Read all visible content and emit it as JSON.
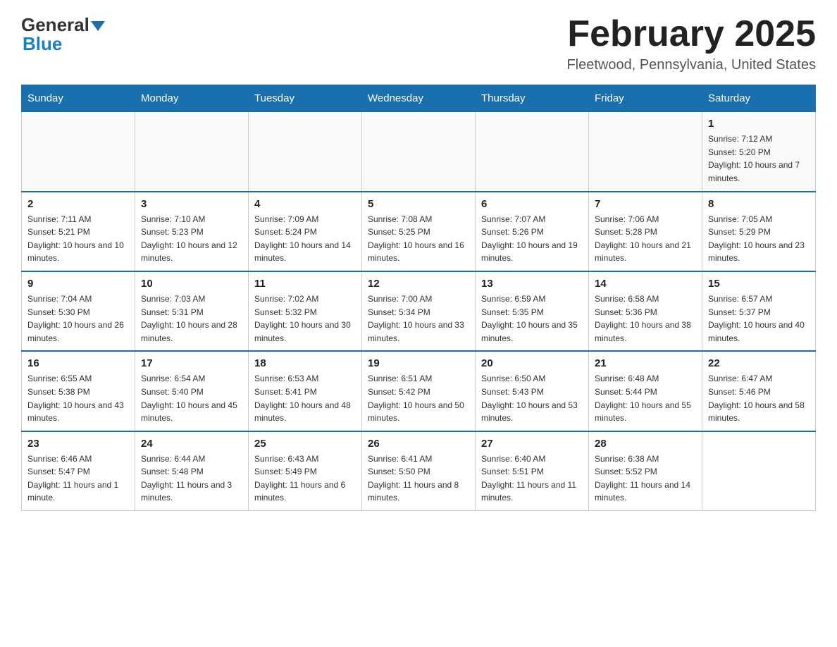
{
  "header": {
    "logo_general": "General",
    "logo_blue": "Blue",
    "month_title": "February 2025",
    "location": "Fleetwood, Pennsylvania, United States"
  },
  "days_of_week": [
    "Sunday",
    "Monday",
    "Tuesday",
    "Wednesday",
    "Thursday",
    "Friday",
    "Saturday"
  ],
  "weeks": [
    [
      {
        "day": "",
        "sunrise": "",
        "sunset": "",
        "daylight": ""
      },
      {
        "day": "",
        "sunrise": "",
        "sunset": "",
        "daylight": ""
      },
      {
        "day": "",
        "sunrise": "",
        "sunset": "",
        "daylight": ""
      },
      {
        "day": "",
        "sunrise": "",
        "sunset": "",
        "daylight": ""
      },
      {
        "day": "",
        "sunrise": "",
        "sunset": "",
        "daylight": ""
      },
      {
        "day": "",
        "sunrise": "",
        "sunset": "",
        "daylight": ""
      },
      {
        "day": "1",
        "sunrise": "Sunrise: 7:12 AM",
        "sunset": "Sunset: 5:20 PM",
        "daylight": "Daylight: 10 hours and 7 minutes."
      }
    ],
    [
      {
        "day": "2",
        "sunrise": "Sunrise: 7:11 AM",
        "sunset": "Sunset: 5:21 PM",
        "daylight": "Daylight: 10 hours and 10 minutes."
      },
      {
        "day": "3",
        "sunrise": "Sunrise: 7:10 AM",
        "sunset": "Sunset: 5:23 PM",
        "daylight": "Daylight: 10 hours and 12 minutes."
      },
      {
        "day": "4",
        "sunrise": "Sunrise: 7:09 AM",
        "sunset": "Sunset: 5:24 PM",
        "daylight": "Daylight: 10 hours and 14 minutes."
      },
      {
        "day": "5",
        "sunrise": "Sunrise: 7:08 AM",
        "sunset": "Sunset: 5:25 PM",
        "daylight": "Daylight: 10 hours and 16 minutes."
      },
      {
        "day": "6",
        "sunrise": "Sunrise: 7:07 AM",
        "sunset": "Sunset: 5:26 PM",
        "daylight": "Daylight: 10 hours and 19 minutes."
      },
      {
        "day": "7",
        "sunrise": "Sunrise: 7:06 AM",
        "sunset": "Sunset: 5:28 PM",
        "daylight": "Daylight: 10 hours and 21 minutes."
      },
      {
        "day": "8",
        "sunrise": "Sunrise: 7:05 AM",
        "sunset": "Sunset: 5:29 PM",
        "daylight": "Daylight: 10 hours and 23 minutes."
      }
    ],
    [
      {
        "day": "9",
        "sunrise": "Sunrise: 7:04 AM",
        "sunset": "Sunset: 5:30 PM",
        "daylight": "Daylight: 10 hours and 26 minutes."
      },
      {
        "day": "10",
        "sunrise": "Sunrise: 7:03 AM",
        "sunset": "Sunset: 5:31 PM",
        "daylight": "Daylight: 10 hours and 28 minutes."
      },
      {
        "day": "11",
        "sunrise": "Sunrise: 7:02 AM",
        "sunset": "Sunset: 5:32 PM",
        "daylight": "Daylight: 10 hours and 30 minutes."
      },
      {
        "day": "12",
        "sunrise": "Sunrise: 7:00 AM",
        "sunset": "Sunset: 5:34 PM",
        "daylight": "Daylight: 10 hours and 33 minutes."
      },
      {
        "day": "13",
        "sunrise": "Sunrise: 6:59 AM",
        "sunset": "Sunset: 5:35 PM",
        "daylight": "Daylight: 10 hours and 35 minutes."
      },
      {
        "day": "14",
        "sunrise": "Sunrise: 6:58 AM",
        "sunset": "Sunset: 5:36 PM",
        "daylight": "Daylight: 10 hours and 38 minutes."
      },
      {
        "day": "15",
        "sunrise": "Sunrise: 6:57 AM",
        "sunset": "Sunset: 5:37 PM",
        "daylight": "Daylight: 10 hours and 40 minutes."
      }
    ],
    [
      {
        "day": "16",
        "sunrise": "Sunrise: 6:55 AM",
        "sunset": "Sunset: 5:38 PM",
        "daylight": "Daylight: 10 hours and 43 minutes."
      },
      {
        "day": "17",
        "sunrise": "Sunrise: 6:54 AM",
        "sunset": "Sunset: 5:40 PM",
        "daylight": "Daylight: 10 hours and 45 minutes."
      },
      {
        "day": "18",
        "sunrise": "Sunrise: 6:53 AM",
        "sunset": "Sunset: 5:41 PM",
        "daylight": "Daylight: 10 hours and 48 minutes."
      },
      {
        "day": "19",
        "sunrise": "Sunrise: 6:51 AM",
        "sunset": "Sunset: 5:42 PM",
        "daylight": "Daylight: 10 hours and 50 minutes."
      },
      {
        "day": "20",
        "sunrise": "Sunrise: 6:50 AM",
        "sunset": "Sunset: 5:43 PM",
        "daylight": "Daylight: 10 hours and 53 minutes."
      },
      {
        "day": "21",
        "sunrise": "Sunrise: 6:48 AM",
        "sunset": "Sunset: 5:44 PM",
        "daylight": "Daylight: 10 hours and 55 minutes."
      },
      {
        "day": "22",
        "sunrise": "Sunrise: 6:47 AM",
        "sunset": "Sunset: 5:46 PM",
        "daylight": "Daylight: 10 hours and 58 minutes."
      }
    ],
    [
      {
        "day": "23",
        "sunrise": "Sunrise: 6:46 AM",
        "sunset": "Sunset: 5:47 PM",
        "daylight": "Daylight: 11 hours and 1 minute."
      },
      {
        "day": "24",
        "sunrise": "Sunrise: 6:44 AM",
        "sunset": "Sunset: 5:48 PM",
        "daylight": "Daylight: 11 hours and 3 minutes."
      },
      {
        "day": "25",
        "sunrise": "Sunrise: 6:43 AM",
        "sunset": "Sunset: 5:49 PM",
        "daylight": "Daylight: 11 hours and 6 minutes."
      },
      {
        "day": "26",
        "sunrise": "Sunrise: 6:41 AM",
        "sunset": "Sunset: 5:50 PM",
        "daylight": "Daylight: 11 hours and 8 minutes."
      },
      {
        "day": "27",
        "sunrise": "Sunrise: 6:40 AM",
        "sunset": "Sunset: 5:51 PM",
        "daylight": "Daylight: 11 hours and 11 minutes."
      },
      {
        "day": "28",
        "sunrise": "Sunrise: 6:38 AM",
        "sunset": "Sunset: 5:52 PM",
        "daylight": "Daylight: 11 hours and 14 minutes."
      },
      {
        "day": "",
        "sunrise": "",
        "sunset": "",
        "daylight": ""
      }
    ]
  ]
}
